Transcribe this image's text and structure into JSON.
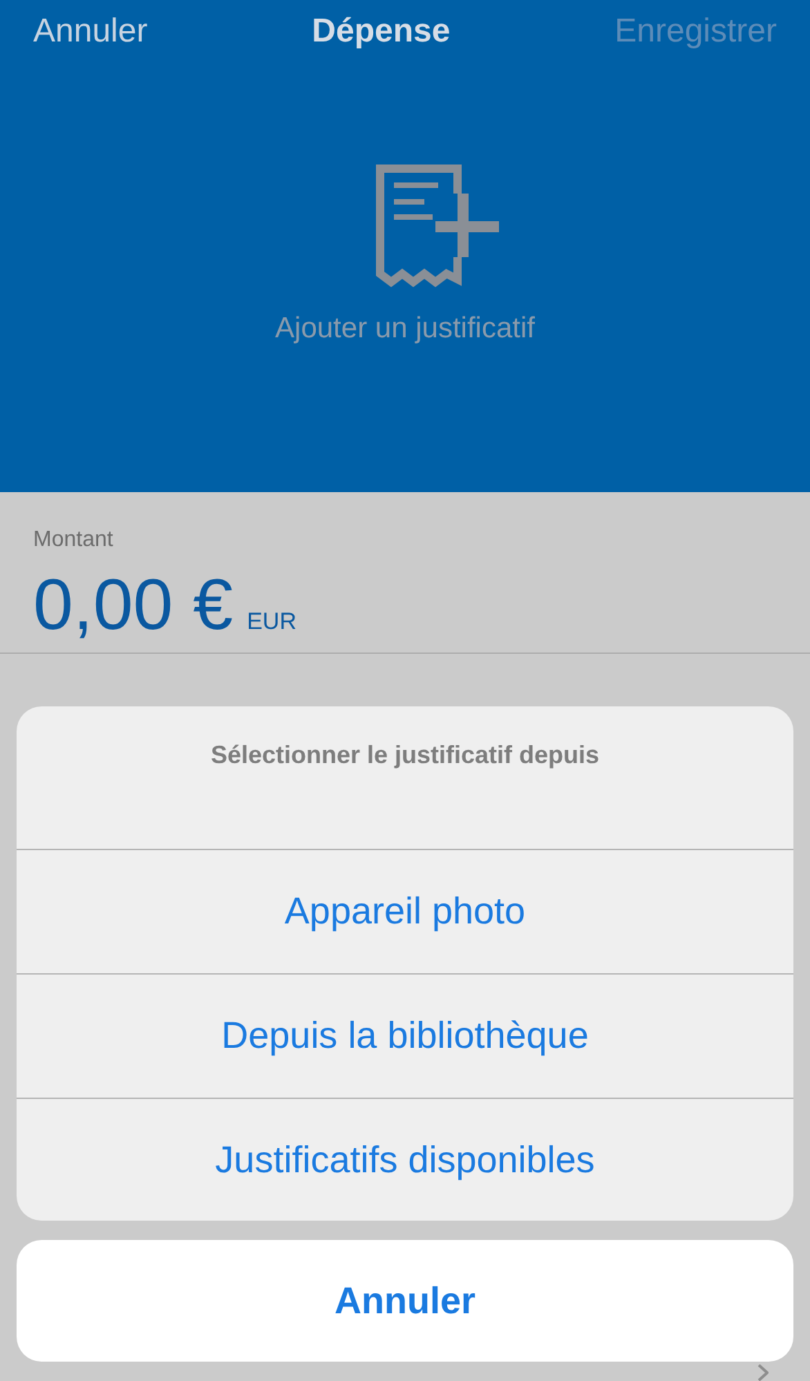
{
  "nav": {
    "cancel": "Annuler",
    "title": "Dépense",
    "save": "Enregistrer",
    "save_disabled": true
  },
  "receipt": {
    "label": "Ajouter un justificatif"
  },
  "amount": {
    "label": "Montant",
    "value": "0,00 €",
    "currency": "EUR"
  },
  "action_sheet": {
    "title": "Sélectionner le justificatif depuis",
    "options": [
      "Appareil photo",
      "Depuis la bibliothèque",
      "Justificatifs disponibles"
    ],
    "cancel": "Annuler"
  }
}
